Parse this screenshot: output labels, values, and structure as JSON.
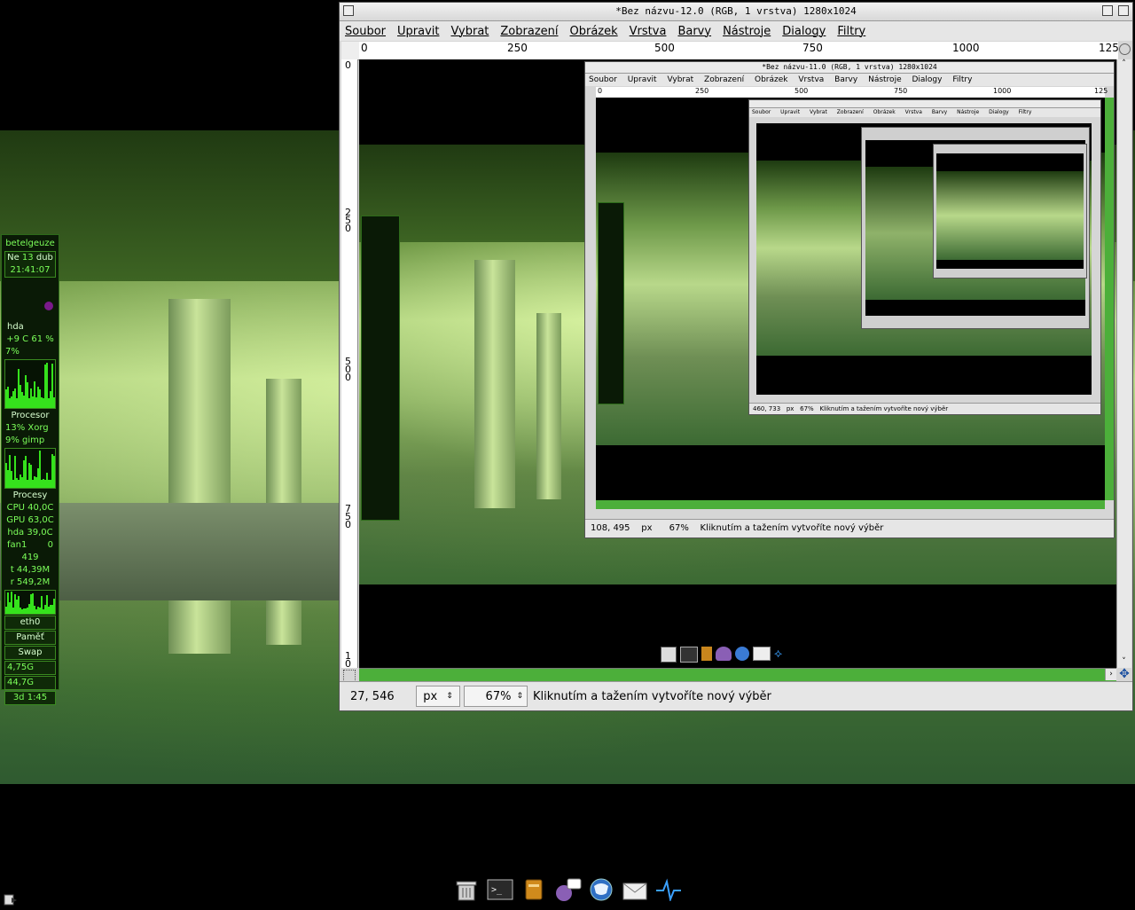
{
  "gimp": {
    "title": "*Bez názvu-12.0 (RGB, 1 vrstva) 1280x1024",
    "menus": [
      "Soubor",
      "Upravit",
      "Vybrat",
      "Zobrazení",
      "Obrázek",
      "Vrstva",
      "Barvy",
      "Nástroje",
      "Dialogy",
      "Filtry"
    ],
    "ruler_h": [
      "0",
      "250",
      "500",
      "750",
      "1000",
      "125"
    ],
    "ruler_v": [
      "0",
      "2\n5\n0",
      "5\n0\n0",
      "7\n5\n0",
      "1\n0"
    ],
    "status": {
      "coords": "27, 546",
      "unit": "px",
      "zoom": "67%",
      "message": "Kliknutím a tažením vytvoříte nový výběr"
    },
    "scrollbar_color": "#4caf3a"
  },
  "nested1": {
    "title": "*Bez názvu-11.0 (RGB, 1 vrstva) 1280x1024",
    "menus": [
      "Soubor",
      "Upravit",
      "Vybrat",
      "Zobrazení",
      "Obrázek",
      "Vrstva",
      "Barvy",
      "Nástroje",
      "Dialogy",
      "Filtry"
    ],
    "ruler": [
      "0",
      "250",
      "500",
      "750",
      "1000",
      "125"
    ],
    "status": {
      "coords": "108, 495",
      "unit": "px",
      "zoom": "67%",
      "message": "Kliknutím a tažením vytvoříte nový výběr"
    }
  },
  "nested2": {
    "menus": [
      "Soubor",
      "Upravit",
      "Vybrat",
      "Zobrazení",
      "Obrázek",
      "Vrstva",
      "Barvy",
      "Nástroje",
      "Dialogy",
      "Filtry"
    ],
    "status": {
      "coords": "460, 733",
      "unit": "px",
      "zoom": "67%",
      "message": "Kliknutím a tažením vytvoříte nový výběr"
    }
  },
  "conky": {
    "host": "betelgeuze",
    "date_day": "Ne",
    "date_num": "13",
    "date_mon": "dub",
    "time": "21:41:07",
    "disk_label": "hda",
    "cpu_line": "+9  C 61 %",
    "cpu_pct": "7%",
    "proc_title": "Procesor",
    "proc1": "13% Xorg",
    "proc2": "9% gimp",
    "procs_title": "Procesy",
    "temp_cpu": "CPU 40,0C",
    "temp_gpu": "GPU 63,0C",
    "temp_hda": "hda  39,0C",
    "fan": "fan1",
    "fan_val": "0",
    "net1": "419",
    "net2": "t  44,39M",
    "net3": "r  549,2M",
    "iface": "eth0",
    "mem_title": "Paměť",
    "swap_title": "Swap",
    "disk1": "4,75G",
    "disk2": "44,7G",
    "uptime": "3d  1:45",
    "accent": "#35e21c"
  },
  "dock": {
    "icons": [
      "trash-icon",
      "terminal-icon",
      "notes-icon",
      "messenger-icon",
      "globe-icon",
      "mail-icon",
      "wave-icon"
    ]
  }
}
